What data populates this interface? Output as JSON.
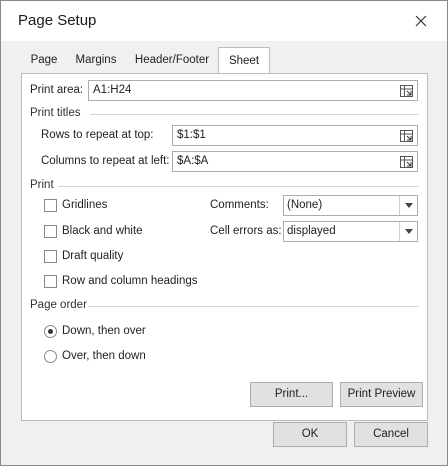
{
  "window": {
    "title": "Page Setup"
  },
  "tabs": [
    {
      "label": "Page"
    },
    {
      "label": "Margins"
    },
    {
      "label": "Header/Footer"
    },
    {
      "label": "Sheet",
      "active": true
    }
  ],
  "sheet": {
    "print_area": {
      "label": "Print area:",
      "value": "A1:H24"
    },
    "print_titles": {
      "header": "Print titles",
      "rows": {
        "label": "Rows to repeat at top:",
        "value": "$1:$1"
      },
      "columns": {
        "label": "Columns to repeat at left:",
        "value": "$A:$A"
      }
    },
    "print": {
      "header": "Print",
      "gridlines": {
        "label": "Gridlines",
        "checked": false
      },
      "black_and_white": {
        "label": "Black and white",
        "checked": false
      },
      "draft_quality": {
        "label": "Draft quality",
        "checked": false
      },
      "row_col_headings": {
        "label": "Row and column headings",
        "checked": false
      },
      "comments": {
        "label": "Comments:",
        "value": "(None)"
      },
      "cell_errors": {
        "label": "Cell errors as:",
        "value": "displayed"
      }
    },
    "page_order": {
      "header": "Page order",
      "options": [
        {
          "label": "Down, then over",
          "selected": true
        },
        {
          "label": "Over, then down",
          "selected": false
        }
      ]
    },
    "buttons": {
      "print": "Print...",
      "print_preview": "Print Preview"
    }
  },
  "footer": {
    "ok": "OK",
    "cancel": "Cancel"
  },
  "icons": {
    "close": "close-icon",
    "range_picker": "range-picker-icon",
    "dropdown": "chevron-down-icon"
  }
}
